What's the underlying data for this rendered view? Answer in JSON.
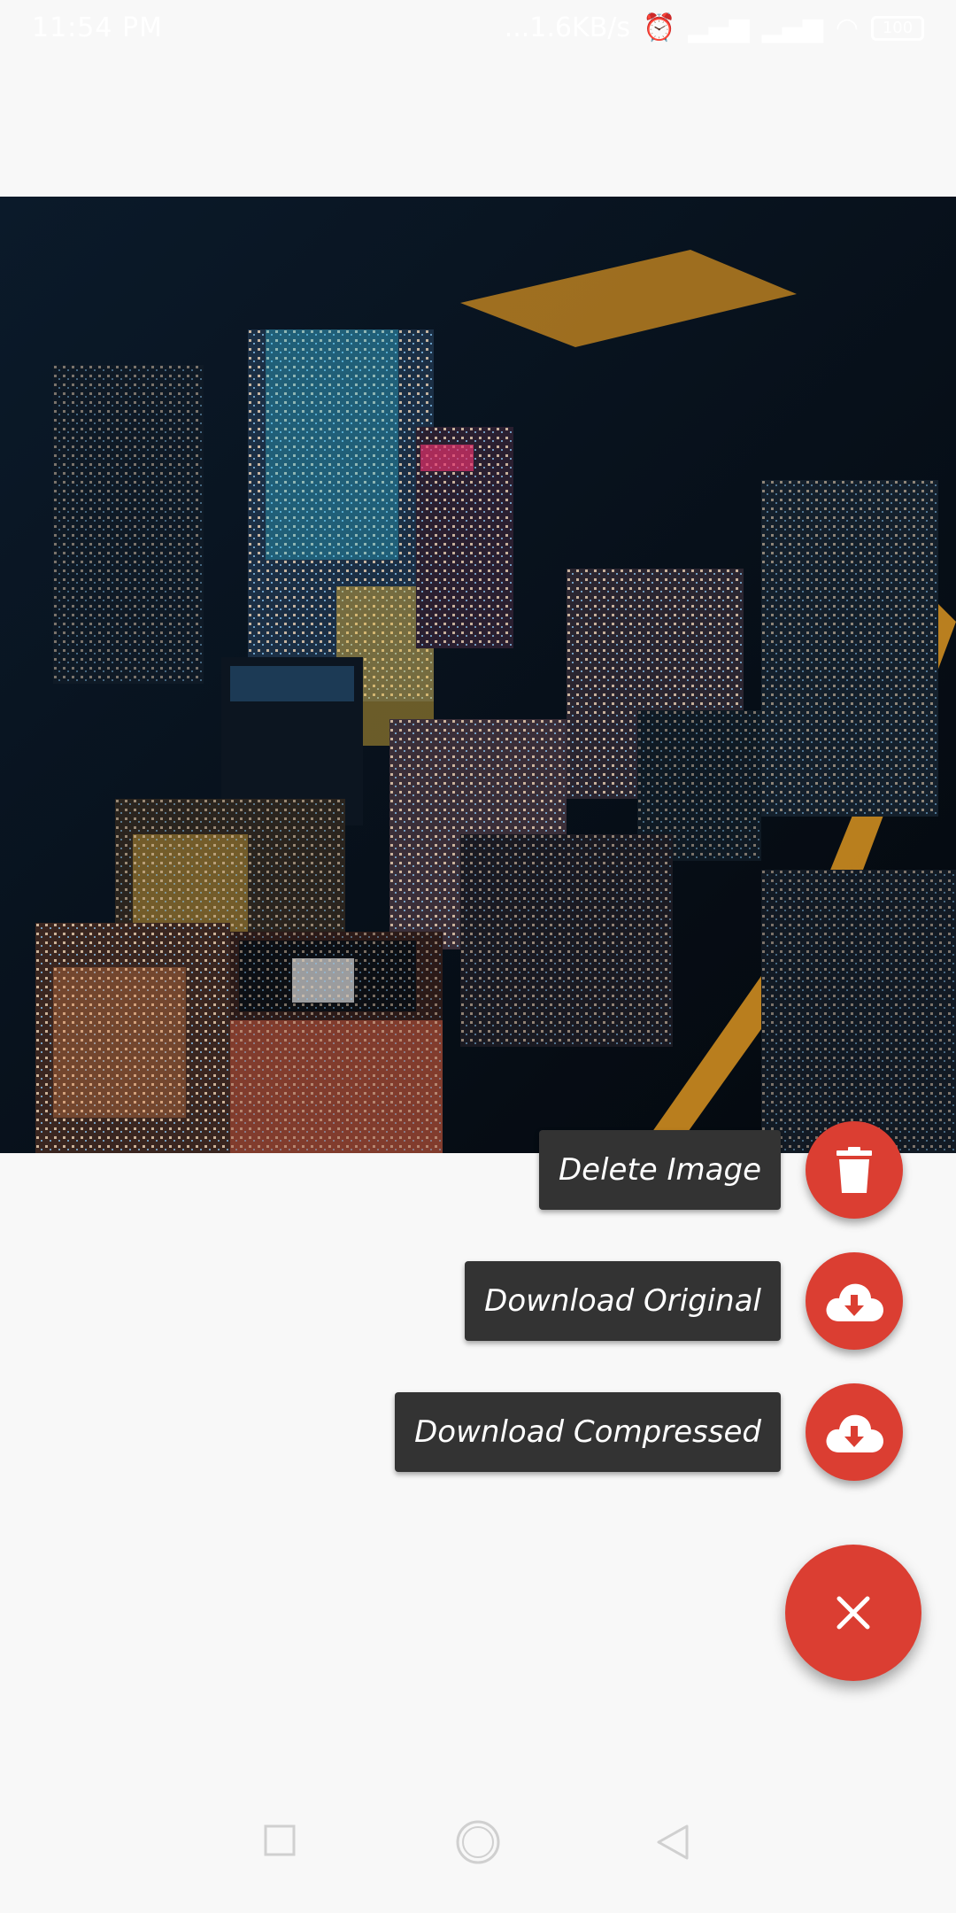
{
  "status_bar": {
    "time": "11:54 PM",
    "network_speed": "...1.6KB/s",
    "battery": "100"
  },
  "speed_dial": {
    "items": [
      {
        "label": "Delete Image",
        "icon": "trash-icon"
      },
      {
        "label": "Download Original",
        "icon": "cloud-download-icon"
      },
      {
        "label": "Download Compressed",
        "icon": "cloud-download-icon"
      }
    ],
    "close_icon": "close-icon"
  },
  "colors": {
    "accent": "#db3e32",
    "label_bg": "#333333",
    "background": "#f8f8f8"
  },
  "nav_bar": {
    "recents_icon": "square-icon",
    "home_icon": "circle-icon",
    "back_icon": "triangle-back-icon"
  }
}
